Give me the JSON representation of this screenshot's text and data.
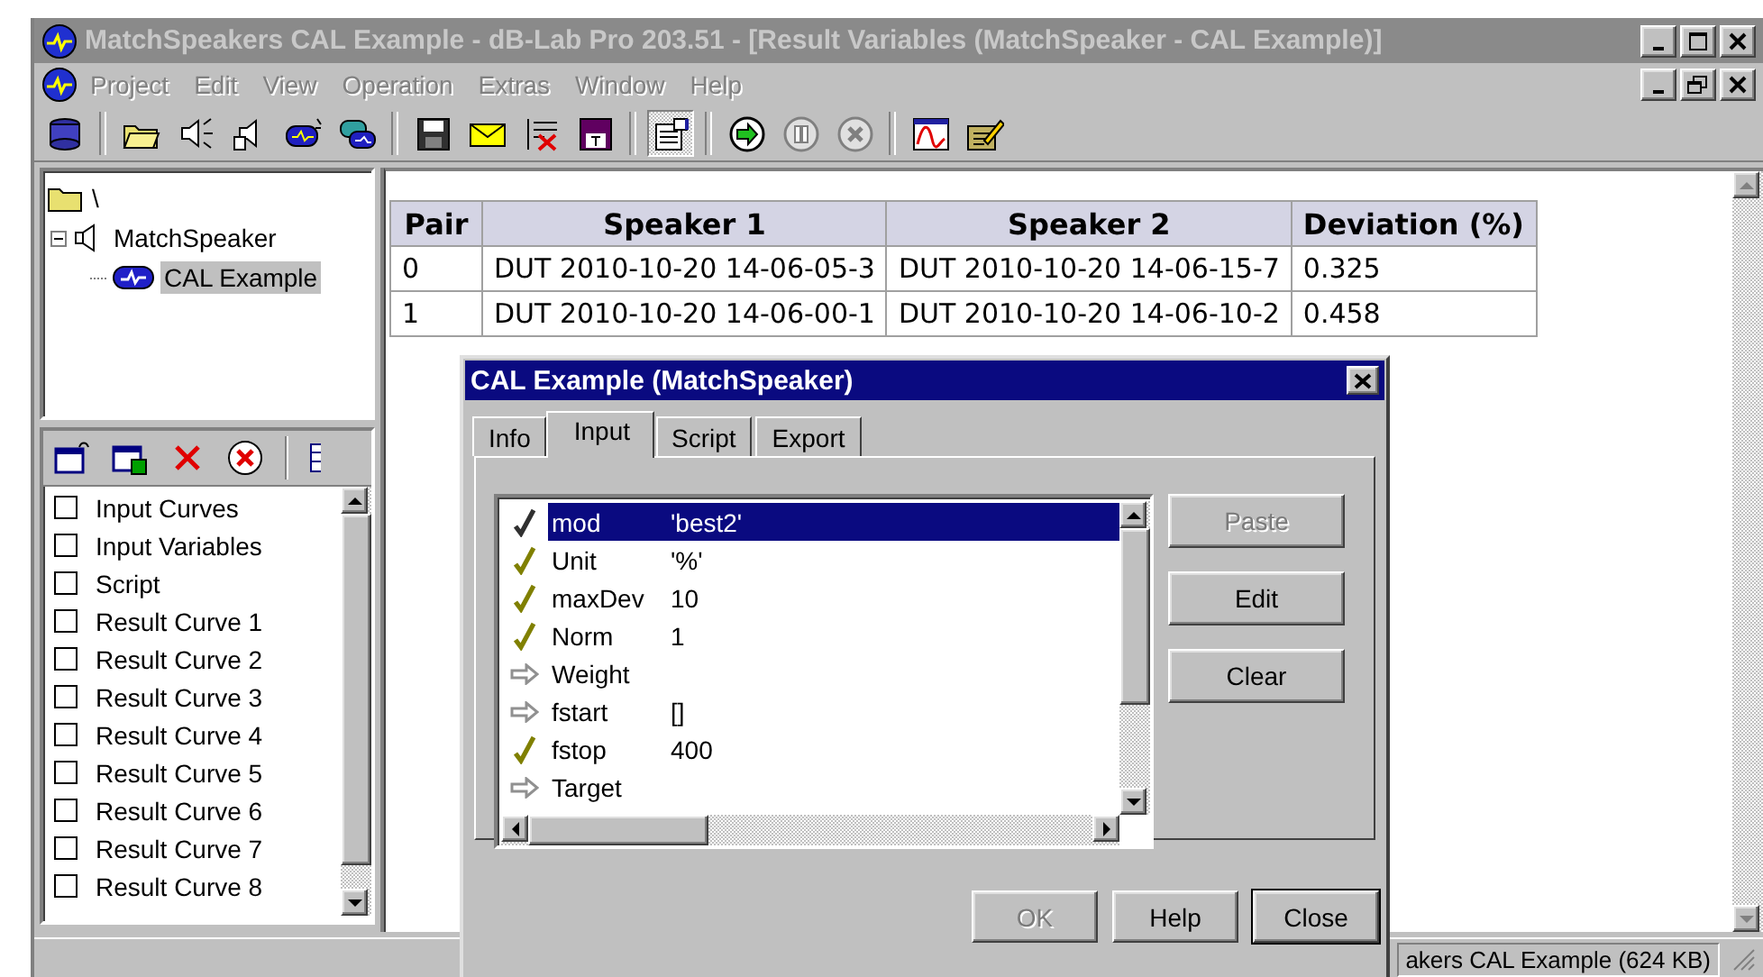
{
  "window": {
    "title": "MatchSpeakers CAL Example - dB-Lab Pro 203.51 - [Result Variables (MatchSpeaker - CAL Example)]",
    "active": false
  },
  "menu": [
    "Project",
    "Edit",
    "View",
    "Operation",
    "Extras",
    "Window",
    "Help"
  ],
  "toolbar_buttons": [
    {
      "pressed": false
    },
    {
      "pressed": false
    },
    {
      "pressed": false
    },
    {
      "pressed": false
    },
    {
      "pressed": false
    },
    {
      "pressed": false
    },
    {
      "pressed": false
    },
    {
      "pressed": false
    },
    {
      "pressed": false
    },
    {
      "pressed": false
    },
    {
      "pressed": true
    },
    {
      "pressed": false
    },
    {
      "pressed": false
    },
    {
      "pressed": false
    },
    {
      "pressed": false
    },
    {
      "pressed": false
    }
  ],
  "tree": [
    {
      "label": "\\",
      "kind": "folder",
      "selected": false,
      "children": [
        {
          "label": "MatchSpeaker",
          "kind": "speaker",
          "selected": false,
          "expanded": true,
          "children": [
            {
              "label": "CAL Example",
              "kind": "cal",
              "selected": true
            }
          ]
        }
      ]
    }
  ],
  "variables_list": [
    {
      "label": "Input Curves",
      "checked": false
    },
    {
      "label": "Input Variables",
      "checked": false
    },
    {
      "label": "Script",
      "checked": false
    },
    {
      "label": "Result Curve 1",
      "checked": false
    },
    {
      "label": "Result Curve 2",
      "checked": false
    },
    {
      "label": "Result Curve 3",
      "checked": false
    },
    {
      "label": "Result Curve 4",
      "checked": false
    },
    {
      "label": "Result Curve 5",
      "checked": false
    },
    {
      "label": "Result Curve 6",
      "checked": false
    },
    {
      "label": "Result Curve 7",
      "checked": false
    },
    {
      "label": "Result Curve 8",
      "checked": false
    }
  ],
  "table": {
    "columns": [
      "Pair",
      "Speaker 1",
      "Speaker 2",
      "Deviation (%)"
    ],
    "rows": [
      [
        "0",
        "DUT 2010-10-20 14-06-05-3",
        "DUT 2010-10-20 14-06-15-7",
        "0.325"
      ],
      [
        "1",
        "DUT 2010-10-20 14-06-00-1",
        "DUT 2010-10-20 14-06-10-2",
        "0.458"
      ]
    ]
  },
  "dialog": {
    "title": "CAL Example (MatchSpeaker)",
    "tabs": [
      {
        "label": "Info",
        "selected": false
      },
      {
        "label": "Input",
        "selected": true
      },
      {
        "label": "Script",
        "selected": false
      },
      {
        "label": "Export",
        "selected": false
      }
    ],
    "variables": [
      {
        "name": "mod",
        "value": "'best2'",
        "defined": true,
        "selected": true
      },
      {
        "name": "Unit",
        "value": "'%'",
        "defined": true,
        "selected": false
      },
      {
        "name": "maxDev",
        "value": "10",
        "defined": true,
        "selected": false
      },
      {
        "name": "Norm",
        "value": "1",
        "defined": true,
        "selected": false
      },
      {
        "name": "Weight",
        "defined": false,
        "selected": false
      },
      {
        "name": "fstart",
        "value": "[]",
        "defined": false,
        "selected": false
      },
      {
        "name": "fstop",
        "value": "400",
        "defined": true,
        "selected": false
      },
      {
        "name": "Target",
        "defined": false,
        "selected": false
      }
    ],
    "side_buttons": [
      {
        "label": "Paste",
        "disabled": true
      },
      {
        "label": "Edit",
        "disabled": false
      },
      {
        "label": "Clear",
        "disabled": false
      }
    ],
    "buttons": [
      {
        "label": "OK",
        "disabled": true,
        "default": false
      },
      {
        "label": "Help",
        "disabled": false,
        "default": false
      },
      {
        "label": "Close",
        "disabled": false,
        "default": true
      }
    ]
  },
  "status_bar": "akers CAL Example (624 KB)"
}
